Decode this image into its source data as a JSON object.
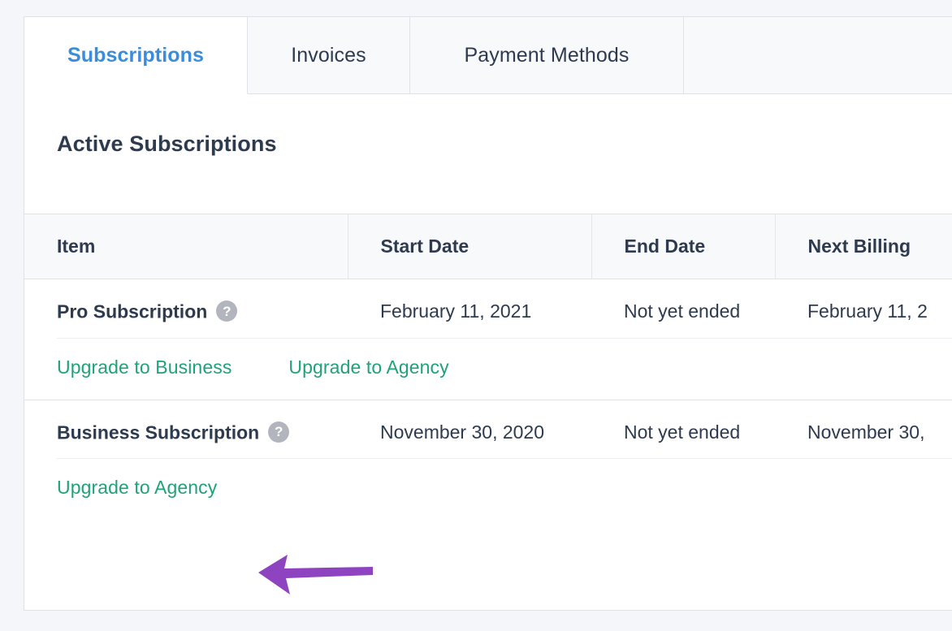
{
  "tabs": [
    {
      "label": "Subscriptions",
      "active": true
    },
    {
      "label": "Invoices",
      "active": false
    },
    {
      "label": "Payment Methods",
      "active": false
    }
  ],
  "section": {
    "title": "Active Subscriptions"
  },
  "table": {
    "headers": [
      "Item",
      "Start Date",
      "End Date",
      "Next Billing"
    ],
    "rows": [
      {
        "item": "Pro Subscription",
        "help_icon": "question-mark-icon",
        "start_date": "February 11, 2021",
        "end_date": "Not yet ended",
        "next_billing": "February 11, 2",
        "upgrade_links": [
          "Upgrade to Business",
          "Upgrade to Agency"
        ]
      },
      {
        "item": "Business Subscription",
        "help_icon": "question-mark-icon",
        "start_date": "November 30, 2020",
        "end_date": "Not yet ended",
        "next_billing": "November 30,",
        "upgrade_links": [
          "Upgrade to Agency"
        ]
      }
    ]
  },
  "annotation": {
    "type": "arrow",
    "direction": "left",
    "color": "#8e44c0",
    "points_to": "Upgrade to Agency"
  },
  "colors": {
    "accent_tab": "#3a8ddc",
    "link_green": "#21a179",
    "text_dark": "#2e3a4e",
    "border": "#dfe3e8",
    "header_bg": "#f8f9fb",
    "page_bg": "#f4f6f9",
    "help_badge": "#b2b5bd",
    "annotation_purple": "#8e44c0"
  }
}
